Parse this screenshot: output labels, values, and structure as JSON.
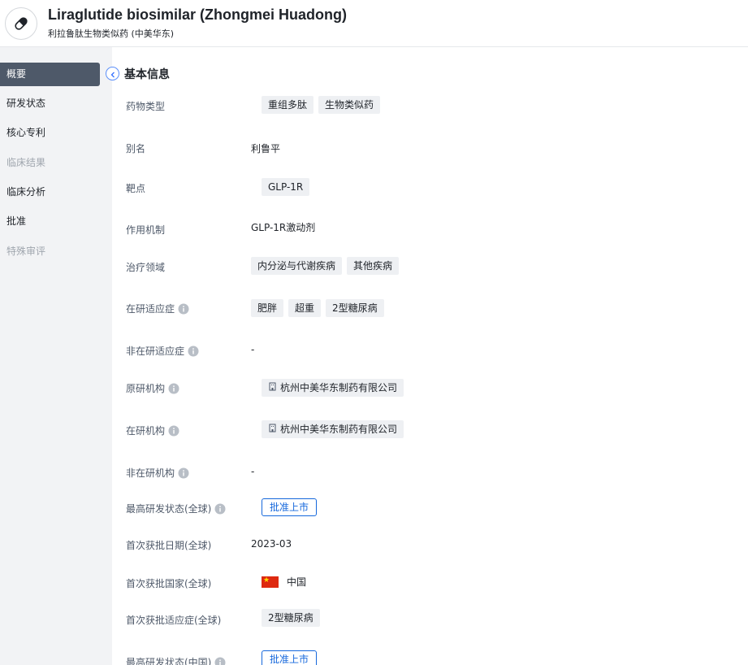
{
  "header": {
    "title": "Liraglutide biosimilar (Zhongmei Huadong)",
    "subtitle": "利拉鲁肽生物类似药 (中美华东)",
    "logo_icon": "pill-icon"
  },
  "sidebar": {
    "items": [
      {
        "label": "概要",
        "state": "active"
      },
      {
        "label": "研发状态",
        "state": "normal"
      },
      {
        "label": "核心专利",
        "state": "normal"
      },
      {
        "label": "临床结果",
        "state": "disabled"
      },
      {
        "label": "临床分析",
        "state": "normal"
      },
      {
        "label": "批准",
        "state": "normal"
      },
      {
        "label": "特殊审评",
        "state": "disabled"
      }
    ]
  },
  "section": {
    "title": "基本信息",
    "collapse_icon": "chevron-left-icon"
  },
  "fields": {
    "drug_type": {
      "label": "药物类型",
      "tags": [
        "重组多肽",
        "生物类似药"
      ]
    },
    "alias": {
      "label": "别名",
      "value": "利鲁平"
    },
    "target": {
      "label": "靶点",
      "tags": [
        "GLP-1R"
      ]
    },
    "mechanism": {
      "label": "作用机制",
      "value": "GLP-1R激动剂"
    },
    "therapeutic_area": {
      "label": "治疗领域",
      "tags": [
        "内分泌与代谢疾病",
        "其他疾病"
      ]
    },
    "active_indication": {
      "label": "在研适应症",
      "tags": [
        "肥胖",
        "超重",
        "2型糖尿病"
      ]
    },
    "inactive_indication": {
      "label": "非在研适应症",
      "value": "-"
    },
    "originator": {
      "label": "原研机构",
      "org": "杭州中美华东制药有限公司"
    },
    "active_org": {
      "label": "在研机构",
      "org": "杭州中美华东制药有限公司"
    },
    "inactive_org": {
      "label": "非在研机构",
      "value": "-"
    },
    "highest_phase_global": {
      "label": "最高研发状态(全球)",
      "status": "批准上市"
    },
    "first_approval_date": {
      "label": "首次获批日期(全球)",
      "value": "2023-03"
    },
    "first_approval_country": {
      "label": "首次获批国家(全球)",
      "value": "中国"
    },
    "first_approval_indication": {
      "label": "首次获批适应症(全球)",
      "tags": [
        "2型糖尿病"
      ]
    },
    "highest_phase_china": {
      "label": "最高研发状态(中国)",
      "status": "批准上市"
    }
  },
  "colors": {
    "accent": "#1668dc",
    "sidebar_bg": "#f2f3f5",
    "sidebar_active": "#4e5969",
    "tag_bg": "#eef0f3",
    "flag_red": "#de2910"
  }
}
